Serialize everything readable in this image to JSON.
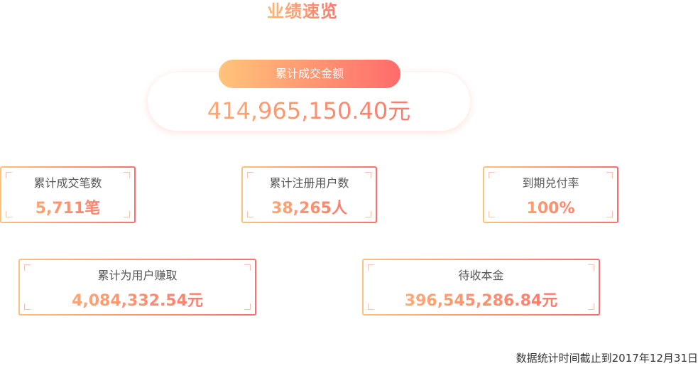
{
  "page": {
    "title": "业绩速览"
  },
  "total": {
    "label": "累计成交金额",
    "value": "414,965,150.40元"
  },
  "stats": [
    {
      "label": "累计成交笔数",
      "value": "5,711笔"
    },
    {
      "label": "累计注册用户数",
      "value": "38,265人"
    },
    {
      "label": "到期兑付率",
      "value": "100%"
    },
    {
      "label": "累计为用户赚取",
      "value": "4,084,332.54元"
    },
    {
      "label": "待收本金",
      "value": "396,545,286.84元"
    }
  ],
  "footnote": "数据统计时间截止到2017年12月31日",
  "colors": {
    "gradient_start": "#ffc07a",
    "gradient_end": "#ff6b6b",
    "label_text": "#555555"
  }
}
